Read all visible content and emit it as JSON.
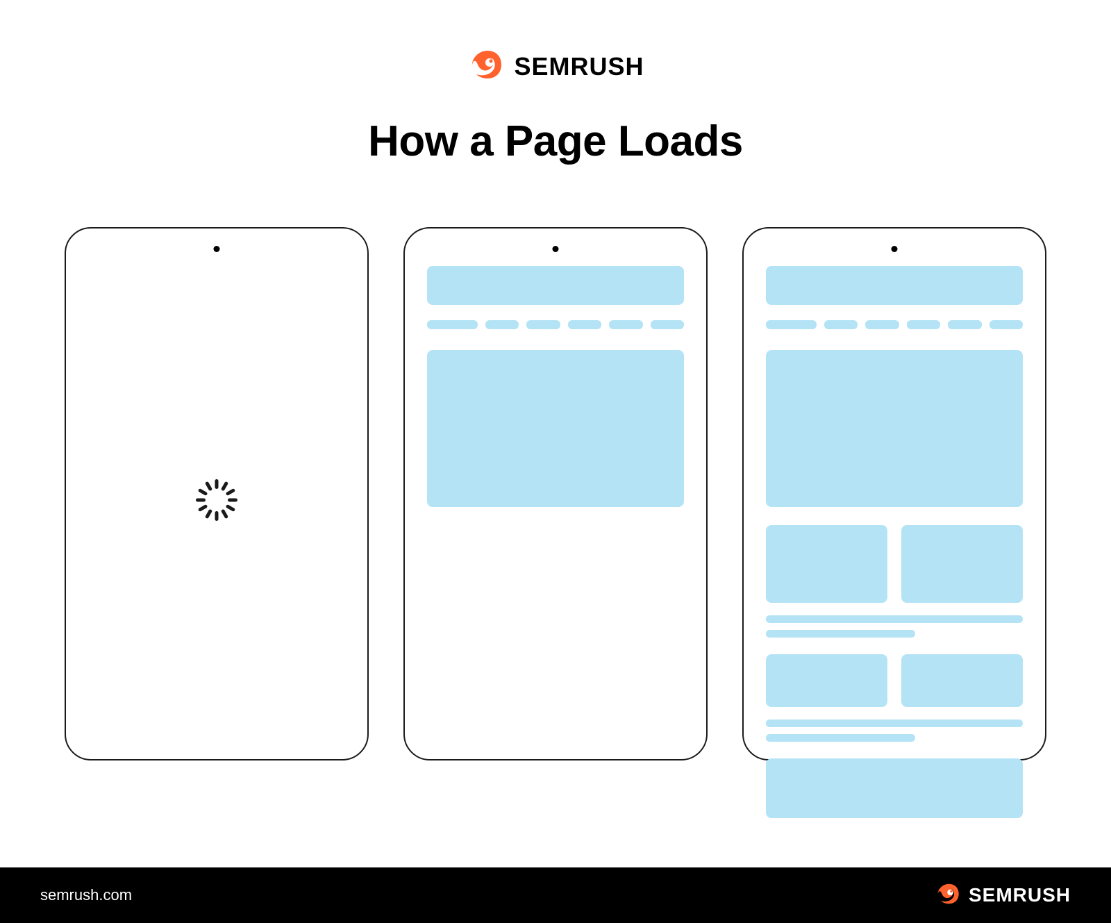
{
  "brand": {
    "name": "SEMRUSH",
    "accent_color": "#ff622d"
  },
  "title": "How a Page Loads",
  "footer": {
    "url": "semrush.com",
    "brand": "SEMRUSH"
  },
  "phones": [
    {
      "state": "loading"
    },
    {
      "state": "partial"
    },
    {
      "state": "complete"
    }
  ]
}
